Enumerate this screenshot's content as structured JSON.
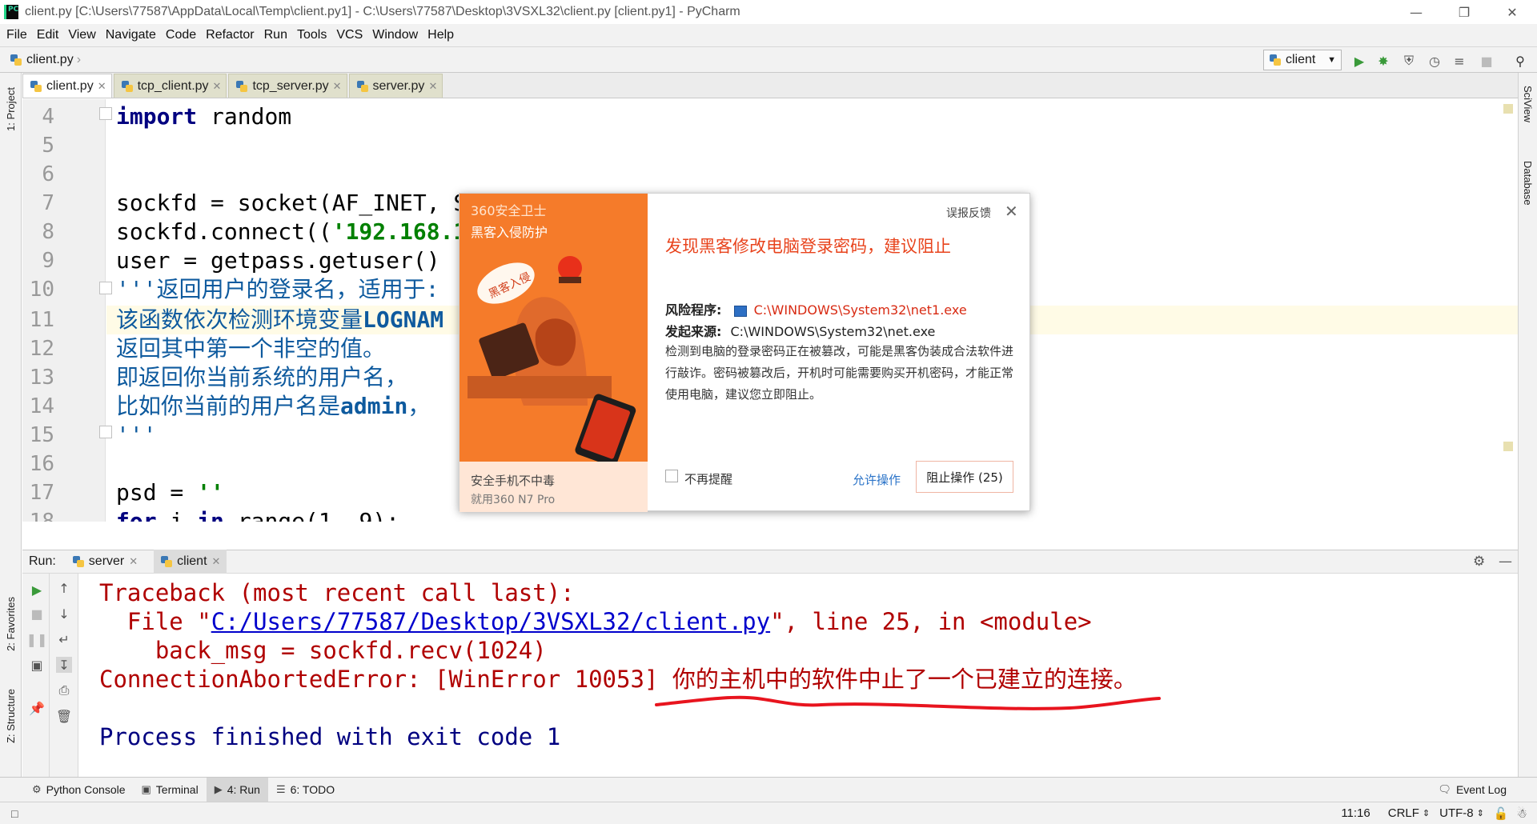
{
  "window": {
    "title": "client.py [C:\\Users\\77587\\AppData\\Local\\Temp\\client.py1] - C:\\Users\\77587\\Desktop\\3VSXL32\\client.py [client.py1] - PyCharm",
    "app_icon": "PC"
  },
  "menu": [
    "File",
    "Edit",
    "View",
    "Navigate",
    "Code",
    "Refactor",
    "Run",
    "Tools",
    "VCS",
    "Window",
    "Help"
  ],
  "navbar": {
    "breadcrumb": "client.py",
    "run_config": "client"
  },
  "left_stripe": {
    "project": "1: Project",
    "favorites": "2: Favorites",
    "structure": "Z: Structure"
  },
  "right_stripe": {
    "sciview": "SciView",
    "database": "Database"
  },
  "tabs": [
    {
      "label": "client.py"
    },
    {
      "label": "tcp_client.py"
    },
    {
      "label": "tcp_server.py"
    },
    {
      "label": "server.py"
    }
  ],
  "editor": {
    "line_numbers": [
      "4",
      "5",
      "6",
      "7",
      "8",
      "9",
      "10",
      "11",
      "12",
      "13",
      "14",
      "15",
      "16",
      "17",
      "18"
    ],
    "lines": {
      "l4_kw": "import",
      "l4_rest": " random",
      "l7": "sockfd = socket(AF_INET, S",
      "l8_pre": "sockfd.connect((",
      "l8_str": "'192.168.1",
      "l9": "user = getpass.getuser()",
      "l10": "'''返回用户的登录名，适用于:",
      "l11_pre": "该函数依次检测环境变量",
      "l11_bold": "LOGNAM",
      "l12": "返回其中第一个非空的值。",
      "l13": "即返回你当前系统的用户名，",
      "l14_pre": "比如你当前的用户名是",
      "l14_bold": "admin",
      "l14_post": "，",
      "l15": "'''",
      "l17_pre": "psd = ",
      "l17_str": "''",
      "l18_kw": "for",
      "l18_rest": " i ",
      "l18_kw2": "in",
      "l18_rest2": " range(1, 9):"
    }
  },
  "run": {
    "label": "Run:",
    "tabs": [
      {
        "label": "server"
      },
      {
        "label": "client"
      }
    ],
    "output": {
      "traceback": "Traceback (most recent call last):",
      "file_pre": "  File \"",
      "file_link": "C:/Users/77587/Desktop/3VSXL32/client.py",
      "file_post": "\", line 25, in <module>",
      "code": "    back_msg = sockfd.recv(1024)",
      "error": "ConnectionAbortedError: [WinError 10053] 你的主机中的软件中止了一个已建立的连接。",
      "process": "Process finished with exit code 1"
    }
  },
  "bottom_tabs": [
    {
      "label": "Python Console"
    },
    {
      "label": "Terminal"
    },
    {
      "label": "4: Run"
    },
    {
      "label": "6: TODO"
    }
  ],
  "event_log": "Event Log",
  "status": {
    "position": "11:16",
    "line_sep": "CRLF",
    "encoding": "UTF-8"
  },
  "popup": {
    "brand": "360安全卫士",
    "subtitle": "黑客入侵防护",
    "badge": "黑客入侵",
    "ad_line1": "安全手机不中毒",
    "ad_line2": "就用360 N7 Pro",
    "feedback": "误报反馈",
    "headline": "发现黑客修改电脑登录密码，建议阻止",
    "risk_label": "风险程序:",
    "risk_value": "C:\\WINDOWS\\System32\\net1.exe",
    "source_label": "发起来源:",
    "source_value": "C:\\WINDOWS\\System32\\net.exe",
    "description": "检测到电脑的登录密码正在被篡改，可能是黑客伪装成合法软件进行敲诈。密码被篡改后，开机时可能需要购买开机密码，才能正常使用电脑，建议您立即阻止。",
    "dont_remind": "不再提醒",
    "allow": "允许操作",
    "block": "阻止操作 (25)"
  },
  "colors": {
    "keyword": "#000080",
    "string": "#008000",
    "docstring": "#0e5a9e",
    "error_text": "#b00000",
    "popup_orange": "#f57b2a",
    "popup_headline": "#e8431c",
    "annotation_underline": "#e8141e"
  }
}
